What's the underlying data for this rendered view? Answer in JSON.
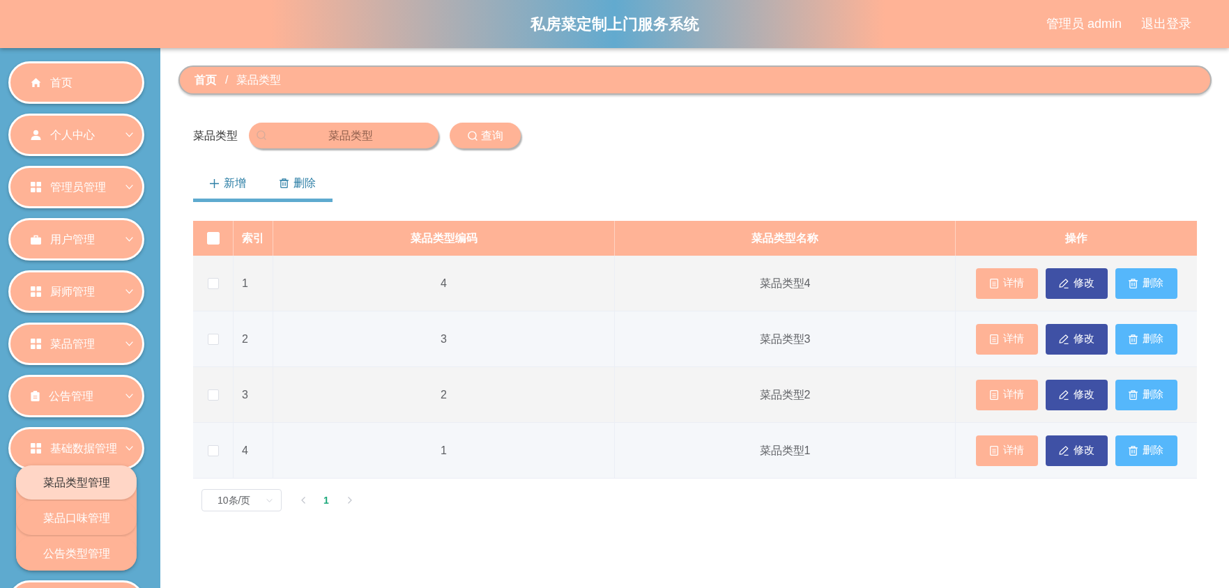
{
  "header": {
    "title": "私房菜定制上门服务系统",
    "user": "管理员 admin",
    "logout": "退出登录"
  },
  "sidebar": {
    "items": [
      {
        "label": "首页",
        "kind": "link",
        "selected": false
      },
      {
        "label": "个人中心",
        "kind": "submenu",
        "selected": false
      },
      {
        "label": "管理员管理",
        "kind": "submenu",
        "selected": false
      },
      {
        "label": "用户管理",
        "kind": "submenu",
        "selected": false
      },
      {
        "label": "厨师管理",
        "kind": "submenu",
        "selected": false
      },
      {
        "label": "菜品管理",
        "kind": "submenu",
        "selected": false
      },
      {
        "label": "公告管理",
        "kind": "submenu",
        "selected": false
      },
      {
        "label": "基础数据管理",
        "kind": "submenu",
        "selected": false,
        "children": [
          {
            "label": "菜品类型管理",
            "selected": true
          },
          {
            "label": "菜品口味管理",
            "selected": false
          },
          {
            "label": "公告类型管理",
            "selected": false
          }
        ]
      },
      {
        "selected": false
      }
    ]
  },
  "breadcrumb": {
    "items": [
      "首页",
      "菜品类型"
    ],
    "separator": "/"
  },
  "search": {
    "label": "菜品类型",
    "placeholder": "菜品类型",
    "button": "查询"
  },
  "toolbar": {
    "buttons": [
      "新增",
      "删除"
    ]
  },
  "table": {
    "select_all": {
      "checked": false
    },
    "columns": [
      "索引",
      "菜品类型编码",
      "菜品类型名称",
      "操作"
    ],
    "rows": [
      {
        "checked": false,
        "index": "1",
        "code": "4",
        "name": "菜品类型4",
        "actions": [
          "详情",
          "修改",
          "删除"
        ]
      },
      {
        "checked": false,
        "index": "2",
        "code": "3",
        "name": "菜品类型3",
        "actions": [
          "详情",
          "修改",
          "删除"
        ]
      },
      {
        "checked": false,
        "index": "3",
        "code": "2",
        "name": "菜品类型2",
        "actions": [
          "详情",
          "修改",
          "删除"
        ]
      },
      {
        "checked": false,
        "index": "4",
        "code": "1",
        "name": "菜品类型1",
        "actions": [
          "详情",
          "修改",
          "删除"
        ]
      }
    ]
  },
  "pagination": {
    "page_size": "10条/页",
    "pages": [
      {
        "label": "1",
        "selected": true
      }
    ]
  }
}
